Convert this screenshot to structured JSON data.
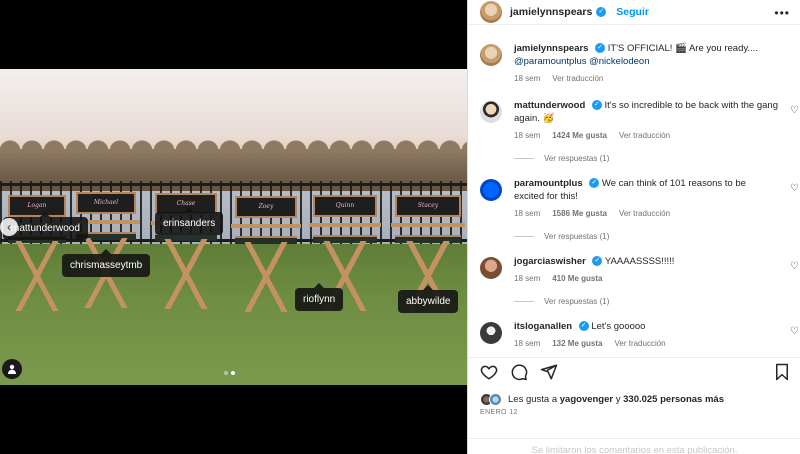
{
  "header": {
    "username": "jamielynnspears",
    "follow_label": "Seguir",
    "more_label": "•••"
  },
  "photo": {
    "chair_names": [
      "Logan",
      "Michael",
      "Chase",
      "Zoey",
      "Quinn",
      "Stacey"
    ],
    "user_tags": [
      "mattunderwood",
      "chrismasseytmb",
      "erinsanders",
      "rioflynn",
      "abbywilde"
    ],
    "nav_prev_icon": "chevron-left-icon",
    "user_tag_icon": "person-icon",
    "dots": 2,
    "active_dot": 1
  },
  "caption": {
    "username": "jamielynnspears",
    "text": "IT'S OFFICIAL! 🎬 Are you ready....",
    "mentions": "@paramountplus @nickelodeon",
    "time": "18 sem",
    "translate": "Ver traducción"
  },
  "comments": [
    {
      "username": "mattunderwood",
      "text": "It's so incredible to be back with the gang again. 🥳",
      "time": "18 sem",
      "likes": "1424 Me gusta",
      "translate": "Ver traducción",
      "replies": "Ver respuestas (1)"
    },
    {
      "username": "paramountplus",
      "text": "We can think of 101 reasons to be excited for this!",
      "time": "18 sem",
      "likes": "1586 Me gusta",
      "translate": "Ver traducción",
      "replies": "Ver respuestas (1)"
    },
    {
      "username": "jogarciaswisher",
      "text": "YAAAASSSS!!!!!",
      "time": "18 sem",
      "likes": "410 Me gusta",
      "translate": "",
      "replies": "Ver respuestas (1)"
    },
    {
      "username": "itsloganallen",
      "text": "Let's gooooo",
      "time": "18 sem",
      "likes": "132 Me gusta",
      "translate": "Ver traducción",
      "replies": ""
    }
  ],
  "likes_line": {
    "prefix": "Les gusta a",
    "user": "yagovenger",
    "middle": "y",
    "count": "330.025 personas más"
  },
  "date": "ENERO 12",
  "comments_limited": "Se limitaron los comentarios en esta publicación.",
  "colors": {
    "accent": "#0095f6",
    "verified": "#1d9bf0",
    "text": "#262626",
    "muted": "#737373"
  }
}
